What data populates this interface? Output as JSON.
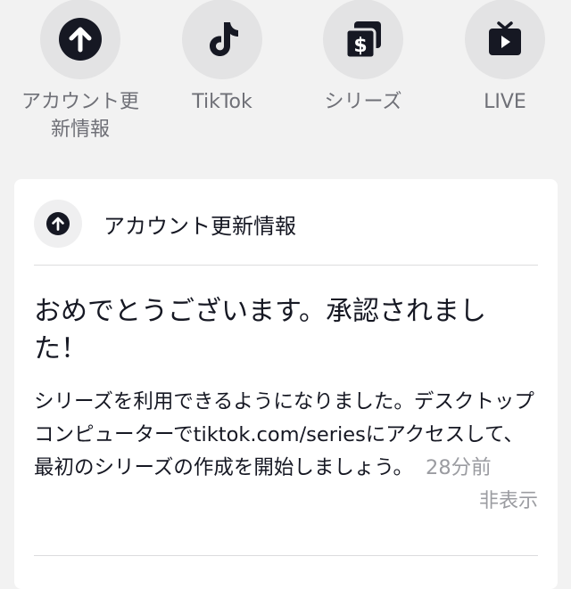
{
  "shortcuts": [
    {
      "label": "アカウント更新情報",
      "icon": "arrow-up-circle-icon"
    },
    {
      "label": "TikTok",
      "icon": "tiktok-logo-icon"
    },
    {
      "label": "シリーズ",
      "icon": "series-dollar-icon"
    },
    {
      "label": "LIVE",
      "icon": "live-tv-icon"
    }
  ],
  "card": {
    "header_title": "アカウント更新情報",
    "header_icon": "arrow-up-circle-icon",
    "message_title": "おめでとうございます。承認されました！",
    "message_body": "シリーズを利用できるようになりました。デスクトップコンピューターでtiktok.com/seriesにアクセスして、最初のシリーズの作成を開始しましょう。",
    "time": "28分前",
    "hide_label": "非表示"
  },
  "colors": {
    "background": "#f2f2f2",
    "icon_circle": "#e3e3e4",
    "icon_dark": "#161823",
    "secondary_text": "#6f7077"
  }
}
